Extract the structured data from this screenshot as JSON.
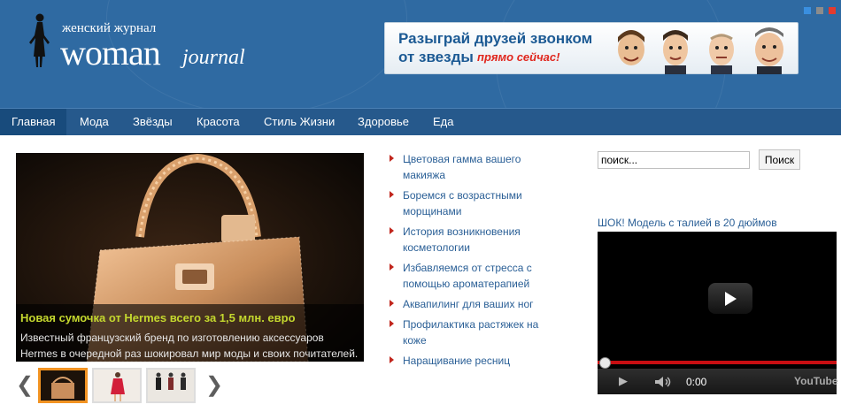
{
  "logo": {
    "subtitle": "женский журнал",
    "name": "woman",
    "name_suffix": "journal"
  },
  "banner": {
    "line1": "Разыграй друзей звонком",
    "line2": "от звезды",
    "line3": "прямо сейчас!"
  },
  "nav": {
    "items": [
      "Главная",
      "Мода",
      "Звёзды",
      "Красота",
      "Стиль Жизни",
      "Здоровье",
      "Еда"
    ]
  },
  "slider": {
    "title": "Новая сумочка от Hermes всего за 1,5 млн. евро",
    "text": "Известный французский бренд по изготовлению аксессуаров Hermes в очередной раз шокировал мир моды и своих почитателей. На этот раз"
  },
  "links": [
    "Цветовая гамма вашего макияжа",
    "Боремся с возрастными морщинами",
    "История возникновения косметологии",
    "Избавляемся от стресса с помощью ароматерапией",
    "Аквапилинг для ваших ног",
    "Профилактика растяжек на коже",
    "Наращивание ресниц"
  ],
  "search": {
    "value": "поиск...",
    "button": "Поиск"
  },
  "video": {
    "title": "ШОК! Модель с талией в 20 дюймов",
    "time": "0:00",
    "brand": "YouTube"
  },
  "colors": {
    "header": "#2f6aa2",
    "nav": "#26598c",
    "link": "#2a5f96",
    "caption_title": "#c4d72e",
    "bullet": "#c1261d"
  }
}
